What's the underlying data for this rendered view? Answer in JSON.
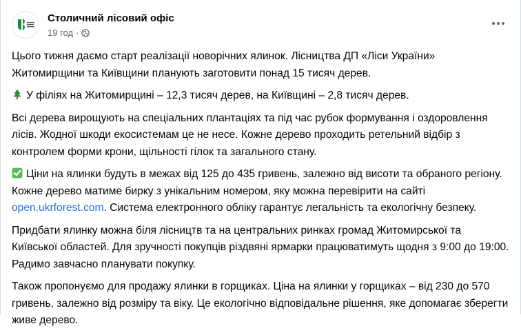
{
  "post": {
    "author": "Столичний лісовий офіс",
    "timestamp": "19 год",
    "separator": "·",
    "privacy_icon": "globe-icon",
    "more_icon": "ellipsis-icon",
    "paragraphs": {
      "p1": "Цього тижня даємо старт реалізації новорічних ялинок. Лісництва ДП «Ліси України» Житомирщини та Київщини планують заготовити понад 15 тисяч дерев.",
      "p2_emoji": "evergreen-tree-icon",
      "p2": "У філіях на Житомирщині – 12,3 тисяч дерев, на Київщині – 2,8 тисяч дерев.",
      "p3": "Всі дерева вирощують на спеціальних плантаціях та під час рубок формування і оздоровлення лісів. Жодної шкоди екосистемам це не несе. Кожне дерево проходить ретельний відбір з контролем форми крони, щільності гілок та загального стану.",
      "p4_emoji": "check-mark-icon",
      "p4_before_link": "Ціни на ялинки будуть в межах від 125 до 435 гривень, залежно від висоти та обраного регіону. Кожне дерево матиме бирку з унікальним номером, яку можна перевірити на сайті",
      "p4_link": "open.ukrforest.com",
      "p4_after_link": ". Система електронного обліку гарантує легальність та екологічну безпеку.",
      "p5": "Придбати ялинку можна біля лісництв та на центральних ринках громад Житомирської та Київської областей. Для зручності покупців різдвяні ярмарки працюватимуть щодня з 9:00 до 19:00. Радимо завчасно планувати покупку.",
      "p6": "Також пропонуємо для продажу ялинки в горщиках. Ціна на ялинки у горщиках – від 230 до 570 гривень, залежно від розміру та віку. Це екологічно відповідальне рішення, яке допомагає зберегти живе дерево."
    }
  },
  "colors": {
    "text": "#050505",
    "secondary_text": "#65676b",
    "link": "#216fdb",
    "logo_green": "#1f8a3b"
  }
}
